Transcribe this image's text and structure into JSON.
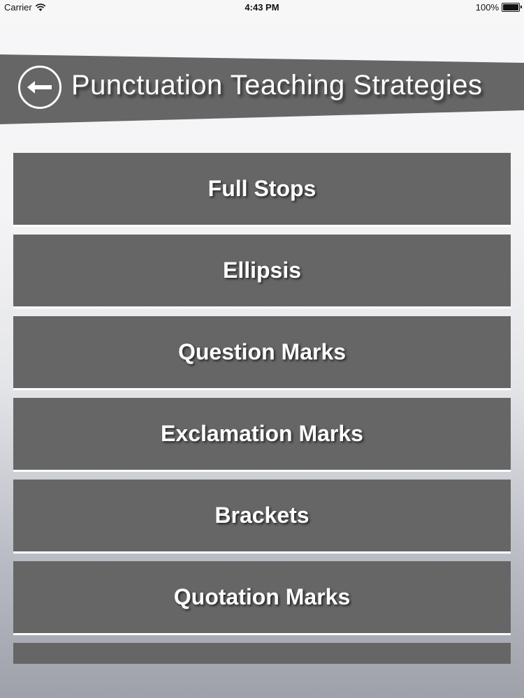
{
  "status_bar": {
    "carrier": "Carrier",
    "time": "4:43 PM",
    "battery": "100%",
    "battery_level": 1.0
  },
  "header": {
    "title": "Punctuation Teaching Strategies",
    "back_icon": "back-arrow-icon",
    "banner_color": "#666667"
  },
  "menu": {
    "items": [
      {
        "label": "Full Stops"
      },
      {
        "label": "Ellipsis"
      },
      {
        "label": "Question Marks"
      },
      {
        "label": "Exclamation Marks"
      },
      {
        "label": "Brackets"
      },
      {
        "label": "Quotation Marks"
      },
      {
        "label": ""
      }
    ],
    "item_color": "#666667",
    "text_color": "#ffffff"
  }
}
